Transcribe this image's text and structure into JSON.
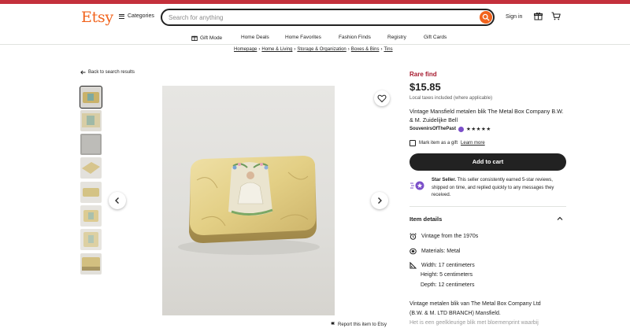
{
  "header": {
    "logo": "Etsy",
    "categories_label": "Categories",
    "search_placeholder": "Search for anything",
    "signin_label": "Sign in"
  },
  "nav": {
    "items": [
      "Gift Mode",
      "Home Deals",
      "Home Favorites",
      "Fashion Finds",
      "Registry",
      "Gift Cards"
    ]
  },
  "breadcrumbs": [
    "Homepage",
    "Home & Living",
    "Storage & Organization",
    "Boxes & Bins",
    "Tins"
  ],
  "breadcrumb_separator": "›",
  "back_label": "Back to search results",
  "thumbnails_count": 8,
  "listing": {
    "badge": "Rare find",
    "price": "$15.85",
    "tax_note": "Local taxes included (where applicable)",
    "title": "Vintage Mansfield metalen blik The Metal Box Company B.W. & M. Zuidelijke Bell",
    "shop_name": "SouvenirsOfThePast",
    "rating_stars": "★★★★★",
    "gift_label": "Mark item as a gift",
    "learn_more": "Learn more",
    "add_to_cart": "Add to cart",
    "star_seller_bold": "Star Seller.",
    "star_seller_text": " This seller consistently earned 5-star reviews, shipped on time, and replied quickly to any messages they received."
  },
  "item_details": {
    "heading": "Item details",
    "vintage": "Vintage from the 1970s",
    "materials": "Materials: Metal",
    "width": "Width: 17 centimeters",
    "height": "Height: 5 centimeters",
    "depth": "Depth: 12 centimeters"
  },
  "description": {
    "line1": "Vintage metalen blik van The Metal Box Company Ltd",
    "line2": "(B.W. & M. LTD BRANCH) Mansfield.",
    "line3": "Het is een geelkleurige blik met bloemenprint waarbij"
  },
  "report_label": "Report this item to Etsy",
  "colors": {
    "brand": "#f1641e",
    "rare_find": "#a61a2e",
    "stripe": "#c4303c",
    "star_seller": "#7b4fc9"
  }
}
